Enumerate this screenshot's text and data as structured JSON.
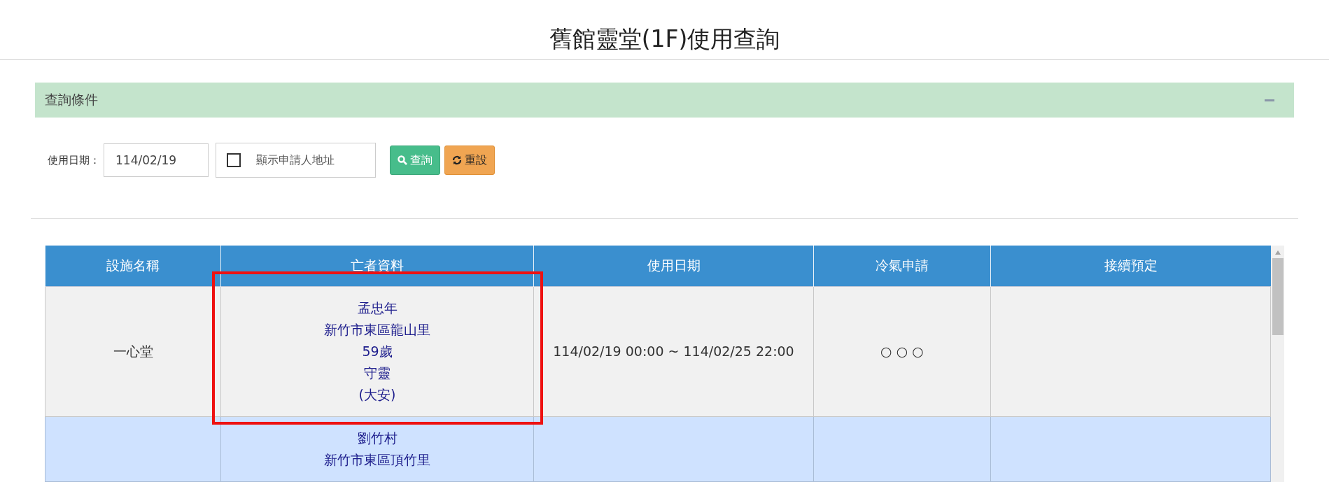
{
  "page_title": "舊館靈堂(1F)使用查詢",
  "query_panel": {
    "title": "查詢條件",
    "expanded": true,
    "date_field": {
      "label": "使用日期：",
      "value": "114/02/19"
    },
    "address_option": {
      "label": "顯示申請人地址",
      "checked": false
    },
    "buttons": [
      {
        "label": "查詢",
        "kind": "search"
      },
      {
        "label": "重設",
        "kind": "reset"
      }
    ]
  },
  "table": {
    "columns": [
      "設施名稱",
      "亡者資料",
      "使用日期",
      "冷氣申請",
      "接續預定"
    ],
    "rows": [
      {
        "facility": "一心堂",
        "deceased": [
          "孟忠年",
          "新竹市東區龍山里",
          "59歲",
          "守靈",
          "(大安)"
        ],
        "deceased_highlighted": true,
        "date_range": "114/02/19 00:00 ~ 114/02/25 22:00",
        "aircon": "○ ○ ○"
      },
      {
        "deceased": [
          "劉竹村",
          "新竹市東區頂竹里"
        ],
        "deceased_highlighted": false
      }
    ]
  }
}
